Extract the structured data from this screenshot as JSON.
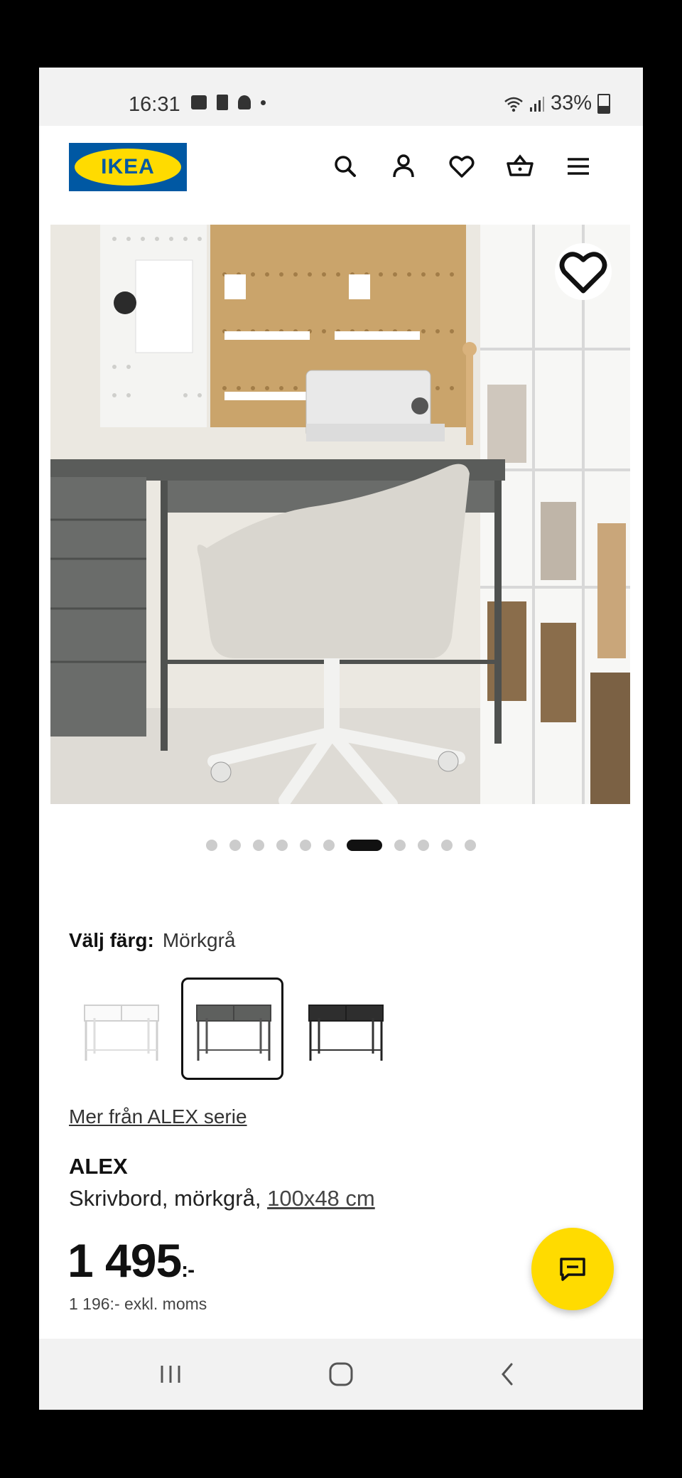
{
  "status_bar": {
    "time": "16:31",
    "battery": "33%"
  },
  "header": {
    "logo_text": "IKEA",
    "icons": [
      "search-icon",
      "account-icon",
      "heart-icon",
      "basket-icon",
      "menu-icon"
    ]
  },
  "gallery": {
    "total_images": 11,
    "active_index": 6
  },
  "color": {
    "label": "Välj färg:",
    "value": "Mörkgrå",
    "options": [
      "vit",
      "mörkgrå",
      "svart"
    ],
    "selected_index": 1
  },
  "product": {
    "series_link": "Mer från ALEX serie",
    "name": "ALEX",
    "desc_prefix": "Skrivbord, mörkgrå,",
    "size": "100x48 cm",
    "price": "1 495",
    "price_suffix": ":-",
    "price_ex_vat": "1 196:- exkl. moms"
  },
  "colors": {
    "brand_blue": "#0058a3",
    "brand_yellow": "#ffdb00"
  }
}
